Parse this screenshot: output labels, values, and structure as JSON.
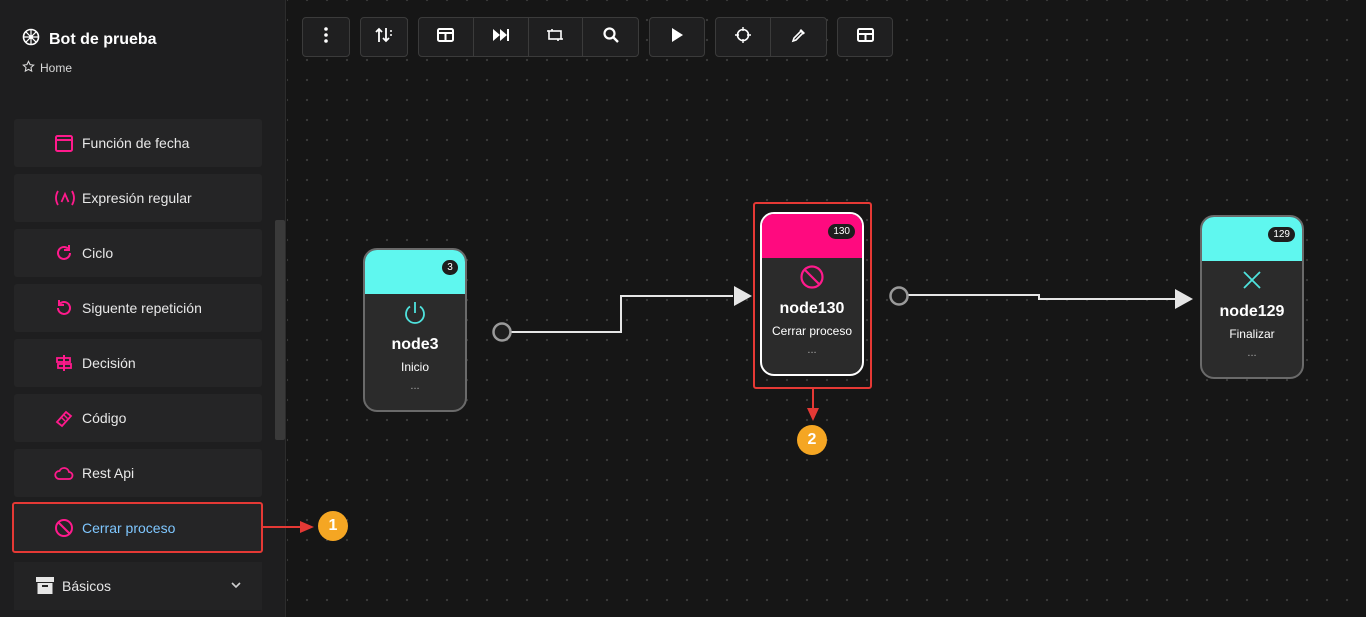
{
  "sidebar": {
    "app_title": "Bot de prueba",
    "home_label": "Home",
    "items": [
      {
        "label": "Función de fecha",
        "icon": "calendar-icon"
      },
      {
        "label": "Expresión regular",
        "icon": "regex-icon"
      },
      {
        "label": "Ciclo",
        "icon": "loop-icon"
      },
      {
        "label": "Siguente repetición",
        "icon": "next-repeat-icon"
      },
      {
        "label": "Decisión",
        "icon": "decision-icon"
      },
      {
        "label": "Código",
        "icon": "code-icon"
      },
      {
        "label": "Rest Api",
        "icon": "cloud-icon"
      },
      {
        "label": "Cerrar proceso",
        "icon": "block-icon"
      }
    ],
    "section": {
      "label": "Básicos",
      "icon": "archive-icon"
    }
  },
  "toolbar": {
    "buttons": [
      "more-icon",
      "sort-icon",
      "layout-icon",
      "skip-forward-icon",
      "transform-icon",
      "search-icon",
      "play-icon",
      "target-icon",
      "eyedropper-icon",
      "table-icon"
    ]
  },
  "nodes": [
    {
      "id": "node3",
      "badge": "3",
      "title": "node3",
      "subtitle": "Inicio",
      "more": "...",
      "head_color": "#5ff7ef",
      "icon": "power-icon"
    },
    {
      "id": "node130",
      "badge": "130",
      "title": "node130",
      "subtitle": "Cerrar proceso",
      "more": "...",
      "head_color": "#ff0a7f",
      "icon": "block-icon"
    },
    {
      "id": "node129",
      "badge": "129",
      "title": "node129",
      "subtitle": "Finalizar",
      "more": "...",
      "head_color": "#5ff7ef",
      "icon": "close-icon"
    }
  ],
  "annotations": [
    "1",
    "2"
  ],
  "colors": {
    "accent": "#ff0a7f",
    "cyan": "#5ff7ef",
    "annotation_red": "#e53935",
    "annotation_orange": "#f5a623"
  }
}
